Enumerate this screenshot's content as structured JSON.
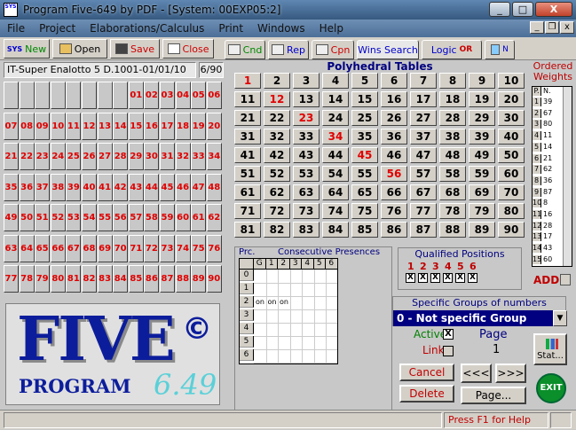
{
  "window": {
    "title": "Program Five-649 by PDF - [System: 00EXP05:2]",
    "app_icon": "SYS",
    "minimize": "_",
    "maximize": "□",
    "close": "X"
  },
  "menu": [
    "File",
    "Project",
    "Elaborations/Calculus",
    "Print",
    "Windows",
    "Help"
  ],
  "mdi_controls": [
    "_",
    "❐",
    "x"
  ],
  "toolbar": {
    "sys_new": "New",
    "open": "Open",
    "save": "Save",
    "close": "Close",
    "tabs": [
      "Cnd",
      "Rep",
      "Cpn",
      "Wins Search",
      "Logic",
      "N"
    ],
    "logic_or": "OR"
  },
  "game": {
    "name": "IT-Super Enalotto 5 D.1001-01/01/10",
    "page": "6/90"
  },
  "numbers_grid": [
    [
      "",
      "",
      "",
      "",
      "",
      "",
      "",
      "",
      "01",
      "02",
      "03",
      "04",
      "05",
      "06"
    ],
    [
      "07",
      "08",
      "09",
      "10",
      "11",
      "12",
      "13",
      "14",
      "15",
      "16",
      "17",
      "18",
      "19",
      "20"
    ],
    [
      "21",
      "22",
      "23",
      "24",
      "25",
      "26",
      "27",
      "28",
      "29",
      "30",
      "31",
      "32",
      "33",
      "34"
    ],
    [
      "35",
      "36",
      "37",
      "38",
      "39",
      "40",
      "41",
      "42",
      "43",
      "44",
      "45",
      "46",
      "47",
      "48"
    ],
    [
      "49",
      "50",
      "51",
      "52",
      "53",
      "54",
      "55",
      "56",
      "57",
      "58",
      "59",
      "60",
      "61",
      "62"
    ],
    [
      "63",
      "64",
      "65",
      "66",
      "67",
      "68",
      "69",
      "70",
      "71",
      "72",
      "73",
      "74",
      "75",
      "76"
    ],
    [
      "77",
      "78",
      "79",
      "80",
      "81",
      "82",
      "83",
      "84",
      "85",
      "86",
      "87",
      "88",
      "89",
      "90"
    ]
  ],
  "logo": {
    "word": "FIVE",
    "copyright": "©",
    "program": "PROGRAM",
    "version": "6.49"
  },
  "polyhedral": {
    "title": "Polyhedral Tables",
    "rows": [
      [
        "1",
        "2",
        "3",
        "4",
        "5",
        "6",
        "7",
        "8",
        "9",
        "10"
      ],
      [
        "11",
        "12",
        "13",
        "14",
        "15",
        "16",
        "17",
        "18",
        "19",
        "20"
      ],
      [
        "21",
        "22",
        "23",
        "24",
        "25",
        "26",
        "27",
        "28",
        "29",
        "30"
      ],
      [
        "31",
        "32",
        "33",
        "34",
        "35",
        "36",
        "37",
        "38",
        "39",
        "40"
      ],
      [
        "41",
        "42",
        "43",
        "44",
        "45",
        "46",
        "47",
        "48",
        "49",
        "50"
      ],
      [
        "51",
        "52",
        "53",
        "54",
        "55",
        "56",
        "57",
        "58",
        "59",
        "60"
      ],
      [
        "61",
        "62",
        "63",
        "64",
        "65",
        "66",
        "67",
        "68",
        "69",
        "70"
      ],
      [
        "71",
        "72",
        "73",
        "74",
        "75",
        "76",
        "77",
        "78",
        "79",
        "80"
      ],
      [
        "81",
        "82",
        "83",
        "84",
        "85",
        "86",
        "87",
        "88",
        "89",
        "90"
      ]
    ],
    "highlighted": [
      "1",
      "12",
      "23",
      "34",
      "45",
      "56"
    ]
  },
  "consecutive": {
    "label_prc": "Prc.",
    "title": "Consecutive Presences",
    "col_headers": [
      "G",
      "1",
      "2",
      "3",
      "4",
      "5",
      "6"
    ],
    "row_headers": [
      "0",
      "1",
      "2",
      "3",
      "4",
      "5",
      "6"
    ],
    "row2_values": [
      "on",
      "on",
      "on"
    ]
  },
  "qualified": {
    "title": "Qualified Positions",
    "positions": [
      "1",
      "2",
      "3",
      "4",
      "5",
      "6"
    ],
    "checked": [
      "X",
      "X",
      "X",
      "X",
      "X",
      "X"
    ]
  },
  "specific_groups": {
    "title": "Specific Groups of numbers",
    "selected": "0 - Not specific Group"
  },
  "weights": {
    "title": "Ordered Weights",
    "head": [
      "P.",
      "N."
    ],
    "rows": [
      [
        "1",
        "39"
      ],
      [
        "2",
        "67"
      ],
      [
        "3",
        "80"
      ],
      [
        "4",
        "11"
      ],
      [
        "5",
        "14"
      ],
      [
        "6",
        "21"
      ],
      [
        "7",
        "62"
      ],
      [
        "8",
        "36"
      ],
      [
        "9",
        "87"
      ],
      [
        "10",
        "8"
      ],
      [
        "11",
        "16"
      ],
      [
        "12",
        "28"
      ],
      [
        "13",
        "17"
      ],
      [
        "14",
        "43"
      ],
      [
        "15",
        "60"
      ]
    ]
  },
  "add_label": "ADD",
  "controls": {
    "active_label": "Active",
    "active_checked": "X",
    "link_label": "Link",
    "page_label": "Page",
    "page_value": "1",
    "stat": "Stat...",
    "cancel": "Cancel",
    "delete": "Delete",
    "prev": "<<<",
    "next": ">>>",
    "page_btn": "Page...",
    "exit": "EXIT"
  },
  "status": {
    "help": "Press F1 for Help"
  }
}
